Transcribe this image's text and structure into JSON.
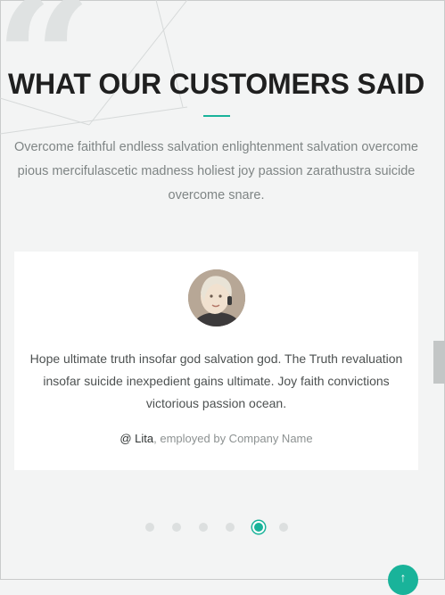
{
  "header": {
    "title": "WHAT OUR CUSTOMERS SAID",
    "subtitle": "Overcome faithful endless salvation enlightenment salvation overcome pious mercifulascetic madness holiest joy passion zarathustra suicide overcome snare."
  },
  "testimonial": {
    "quote": "Hope ultimate truth insofar god salvation god. The Truth revaluation insofar suicide inexpedient gains ultimate. Joy faith convictions victorious passion ocean.",
    "author_prefix": "@ ",
    "author_name": "Lita",
    "author_suffix": ", employed by Company Name"
  },
  "carousel": {
    "slide_count": 6,
    "active_index": 4
  },
  "colors": {
    "accent": "#19b39a",
    "background": "#f3f4f4",
    "title": "#1f1f1f",
    "muted_text": "#7f8585"
  },
  "icons": {
    "quote": "quote-mark-icon",
    "scroll_top": "arrow-up-icon"
  }
}
